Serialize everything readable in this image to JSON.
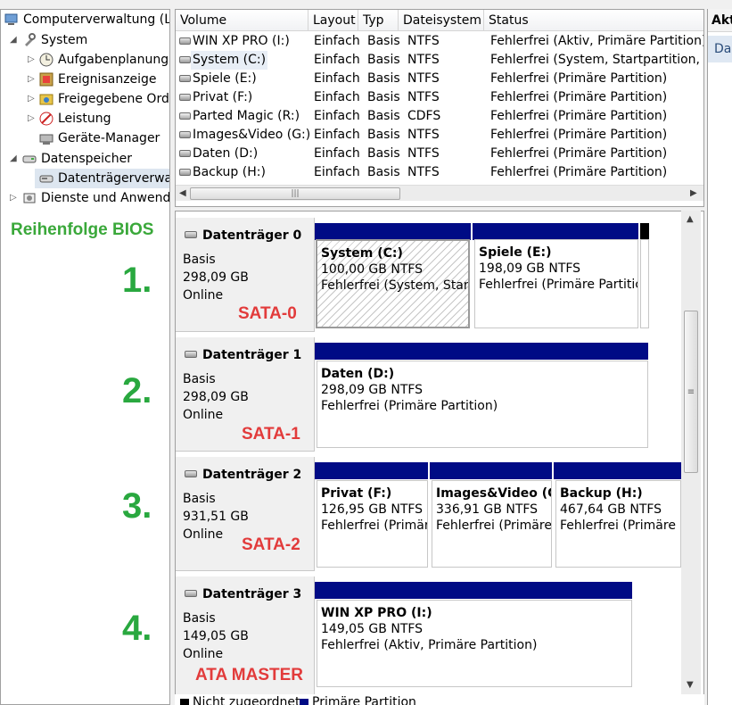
{
  "tree": {
    "items": [
      {
        "label": "Computerverwaltung (Lo",
        "icon": "computer-management-icon"
      },
      {
        "label": "System",
        "icon": "tools-icon"
      },
      {
        "label": "Aufgabenplanung",
        "icon": "clock-icon"
      },
      {
        "label": "Ereignisanzeige",
        "icon": "event-viewer-icon"
      },
      {
        "label": "Freigegebene Ordr",
        "icon": "shared-folder-icon"
      },
      {
        "label": "Leistung",
        "icon": "performance-icon"
      },
      {
        "label": "Geräte-Manager",
        "icon": "device-manager-icon"
      },
      {
        "label": "Datenspeicher",
        "icon": "storage-icon"
      },
      {
        "label": "Datenträgerverwalt",
        "icon": "disk-management-icon"
      },
      {
        "label": "Dienste und Anwendu",
        "icon": "services-icon"
      }
    ]
  },
  "annotation": {
    "title": "Reihenfolge BIOS",
    "numbers": [
      "1.",
      "2.",
      "3.",
      "4."
    ],
    "ports": [
      "SATA-0",
      "SATA-1",
      "SATA-2",
      "ATA MASTER"
    ],
    "colors": {
      "green": "#29a83f",
      "red": "#e23b3b"
    }
  },
  "volume_list": {
    "columns": [
      "Volume",
      "Layout",
      "Typ",
      "Dateisystem",
      "Status"
    ],
    "rows": [
      {
        "volume": "WIN XP PRO (I:)",
        "layout": "Einfach",
        "typ": "Basis",
        "fs": "NTFS",
        "status": "Fehlerfrei (Aktiv, Primäre Partition)"
      },
      {
        "volume": "System (C:)",
        "layout": "Einfach",
        "typ": "Basis",
        "fs": "NTFS",
        "status": "Fehlerfrei (System, Startpartition, Au"
      },
      {
        "volume": "Spiele (E:)",
        "layout": "Einfach",
        "typ": "Basis",
        "fs": "NTFS",
        "status": "Fehlerfrei (Primäre Partition)"
      },
      {
        "volume": "Privat (F:)",
        "layout": "Einfach",
        "typ": "Basis",
        "fs": "NTFS",
        "status": "Fehlerfrei (Primäre Partition)"
      },
      {
        "volume": "Parted Magic (R:)",
        "layout": "Einfach",
        "typ": "Basis",
        "fs": "CDFS",
        "status": "Fehlerfrei (Primäre Partition)"
      },
      {
        "volume": "Images&Video (G:)",
        "layout": "Einfach",
        "typ": "Basis",
        "fs": "NTFS",
        "status": "Fehlerfrei (Primäre Partition)"
      },
      {
        "volume": "Daten (D:)",
        "layout": "Einfach",
        "typ": "Basis",
        "fs": "NTFS",
        "status": "Fehlerfrei (Primäre Partition)"
      },
      {
        "volume": "Backup (H:)",
        "layout": "Einfach",
        "typ": "Basis",
        "fs": "NTFS",
        "status": "Fehlerfrei (Primäre Partition)"
      }
    ]
  },
  "disks": [
    {
      "name": "Datenträger 0",
      "type": "Basis",
      "size": "298,09 GB",
      "state": "Online",
      "partitions": [
        {
          "name": "System  (C:)",
          "size": "100,00 GB NTFS",
          "status": "Fehlerfrei (System, Startp"
        },
        {
          "name": "Spiele  (E:)",
          "size": "198,09 GB NTFS",
          "status": "Fehlerfrei (Primäre Partitic"
        }
      ]
    },
    {
      "name": "Datenträger 1",
      "type": "Basis",
      "size": "298,09 GB",
      "state": "Online",
      "partitions": [
        {
          "name": "Daten  (D:)",
          "size": "298,09 GB NTFS",
          "status": "Fehlerfrei (Primäre Partition)"
        }
      ]
    },
    {
      "name": "Datenträger 2",
      "type": "Basis",
      "size": "931,51 GB",
      "state": "Online",
      "partitions": [
        {
          "name": "Privat  (F:)",
          "size": "126,95 GB NTFS",
          "status": "Fehlerfrei (Primär"
        },
        {
          "name": "Images&Video  (C",
          "size": "336,91 GB NTFS",
          "status": "Fehlerfrei (Primäre"
        },
        {
          "name": "Backup  (H:)",
          "size": "467,64 GB NTFS",
          "status": "Fehlerfrei (Primäre l"
        }
      ]
    },
    {
      "name": "Datenträger 3",
      "type": "Basis",
      "size": "149,05 GB",
      "state": "Online",
      "partitions": [
        {
          "name": "WIN XP PRO  (I:)",
          "size": "149,05 GB NTFS",
          "status": "Fehlerfrei (Aktiv, Primäre Partition)"
        }
      ]
    }
  ],
  "legend": {
    "unallocated": "Nicht zugeordnet",
    "primary": "Primäre Partition"
  },
  "action_pane": {
    "header": "Akti",
    "item": "Da"
  }
}
